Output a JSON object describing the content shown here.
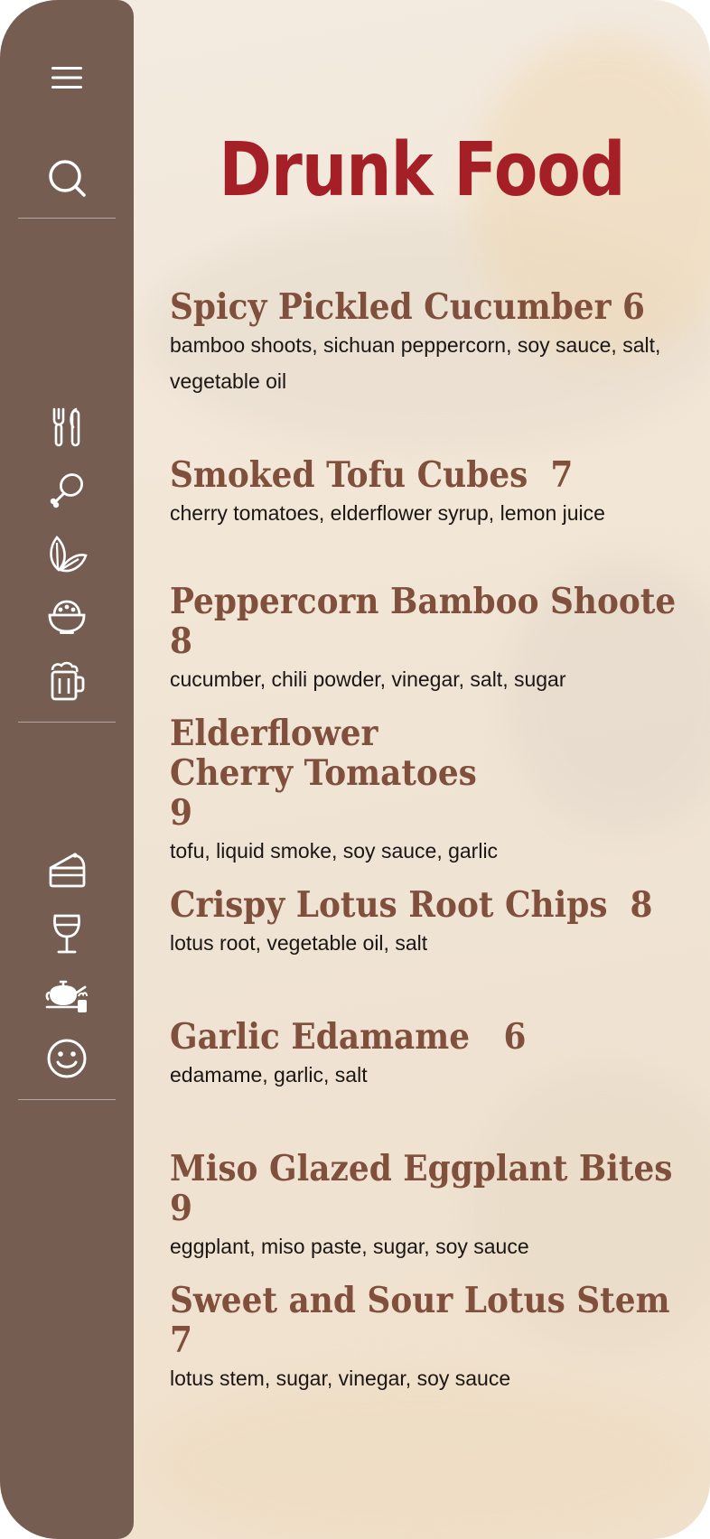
{
  "page": {
    "title": "Drunk Food"
  },
  "colors": {
    "sidebar": "#755d52",
    "title": "#a51f27",
    "item_name": "#80503d",
    "item_desc": "#1a1614",
    "background": "#f2e6d6"
  },
  "sidebar": {
    "top": [
      {
        "icon": "menu-icon"
      },
      {
        "icon": "search-icon"
      }
    ],
    "group1": [
      {
        "icon": "fork-knife-icon"
      },
      {
        "icon": "drumstick-icon"
      },
      {
        "icon": "leaf-icon"
      },
      {
        "icon": "bowl-icon"
      },
      {
        "icon": "beer-mug-icon"
      }
    ],
    "group2": [
      {
        "icon": "cake-icon"
      },
      {
        "icon": "wine-glass-icon"
      },
      {
        "icon": "teapot-icon"
      },
      {
        "icon": "smiley-icon"
      }
    ]
  },
  "menu": {
    "items": [
      {
        "name": "Spicy Pickled Cucumber 6",
        "desc": "bamboo shoots, sichuan peppercorn, soy sauce, salt, vegetable oil"
      },
      {
        "name": "Smoked Tofu Cubes  7",
        "desc": "cherry tomatoes, elderflower syrup, lemon juice"
      },
      {
        "name": "Peppercorn Bamboo Shoote 8",
        "desc": "cucumber, chili powder, vinegar, salt, sugar"
      },
      {
        "name": "Elderflower Cherry Tomatoes  9",
        "desc": "tofu, liquid smoke, soy sauce, garlic"
      },
      {
        "name": "Crispy Lotus Root Chips  8",
        "desc": "lotus root, vegetable oil, salt"
      },
      {
        "name": "Garlic Edamame   6",
        "desc": "edamame, garlic, salt"
      },
      {
        "name": "Miso Glazed Eggplant Bites  9",
        "desc": "eggplant, miso paste, sugar, soy sauce"
      },
      {
        "name": "Sweet and Sour Lotus Stem 7",
        "desc": "lotus stem, sugar, vinegar, soy sauce"
      }
    ]
  }
}
